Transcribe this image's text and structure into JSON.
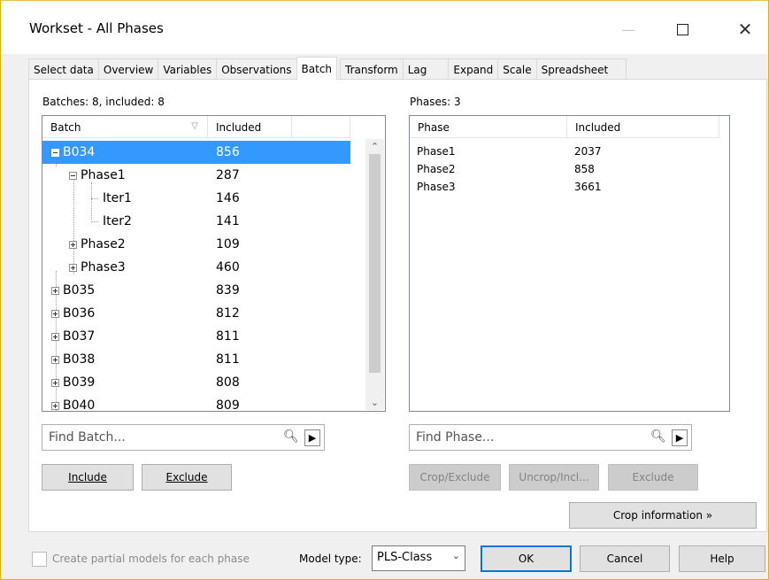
{
  "window": {
    "title": "Workset - All Phases"
  },
  "tabs": [
    {
      "label": "Select data",
      "active": false
    },
    {
      "label": "Overview",
      "active": false
    },
    {
      "label": "Variables",
      "active": false
    },
    {
      "label": "Observations",
      "active": false
    },
    {
      "label": "Batch",
      "active": true
    },
    {
      "label": "Transform",
      "active": false
    },
    {
      "label": "Lag",
      "active": false
    },
    {
      "label": "Expand",
      "active": false
    },
    {
      "label": "Scale",
      "active": false
    },
    {
      "label": "Spreadsheet",
      "active": false
    }
  ],
  "batches": {
    "summary": "Batches: 8, included: 8",
    "columns": {
      "batch": "Batch",
      "included": "Included"
    },
    "rows": [
      {
        "name": "B034",
        "value": "856",
        "selected": true,
        "expanded": true
      },
      {
        "name": "Phase1",
        "value": "287",
        "expanded": true
      },
      {
        "name": "Iter1",
        "value": "146"
      },
      {
        "name": "Iter2",
        "value": "141"
      },
      {
        "name": "Phase2",
        "value": "109",
        "expanded": false
      },
      {
        "name": "Phase3",
        "value": "460",
        "expanded": false
      },
      {
        "name": "B035",
        "value": "839",
        "expanded": false
      },
      {
        "name": "B036",
        "value": "812",
        "expanded": false
      },
      {
        "name": "B037",
        "value": "811",
        "expanded": false
      },
      {
        "name": "B038",
        "value": "811",
        "expanded": false
      },
      {
        "name": "B039",
        "value": "808",
        "expanded": false
      },
      {
        "name": "B040",
        "value": "809",
        "expanded": false
      }
    ],
    "find_placeholder": "Find Batch...",
    "include_label": "Include",
    "exclude_label": "Exclude"
  },
  "phases": {
    "summary": "Phases: 3",
    "columns": {
      "phase": "Phase",
      "included": "Included"
    },
    "rows": [
      {
        "name": "Phase1",
        "value": "2037"
      },
      {
        "name": "Phase2",
        "value": "858"
      },
      {
        "name": "Phase3",
        "value": "3661"
      }
    ],
    "find_placeholder": "Find Phase...",
    "crop_exclude_label": "Crop/Exclude",
    "uncrop_label": "Uncrop/Incl...",
    "exclude_label": "Exclude",
    "crop_info_label": "Crop information »"
  },
  "footer": {
    "partial_models_label": "Create partial models for each phase",
    "partial_models_checked": false,
    "model_type_label": "Model type:",
    "model_type_value": "PLS-Class",
    "ok_label": "OK",
    "cancel_label": "Cancel",
    "help_label": "Help"
  },
  "icons": {
    "minimize": "minimize-icon",
    "maximize": "maximize-icon",
    "close": "close-icon",
    "search": "search-icon",
    "go": "play-arrow-icon",
    "expand": "tree-expand-icon",
    "collapse": "tree-collapse-icon"
  },
  "colors": {
    "selection": "#3399ff",
    "default_button_border": "#0078d7"
  }
}
